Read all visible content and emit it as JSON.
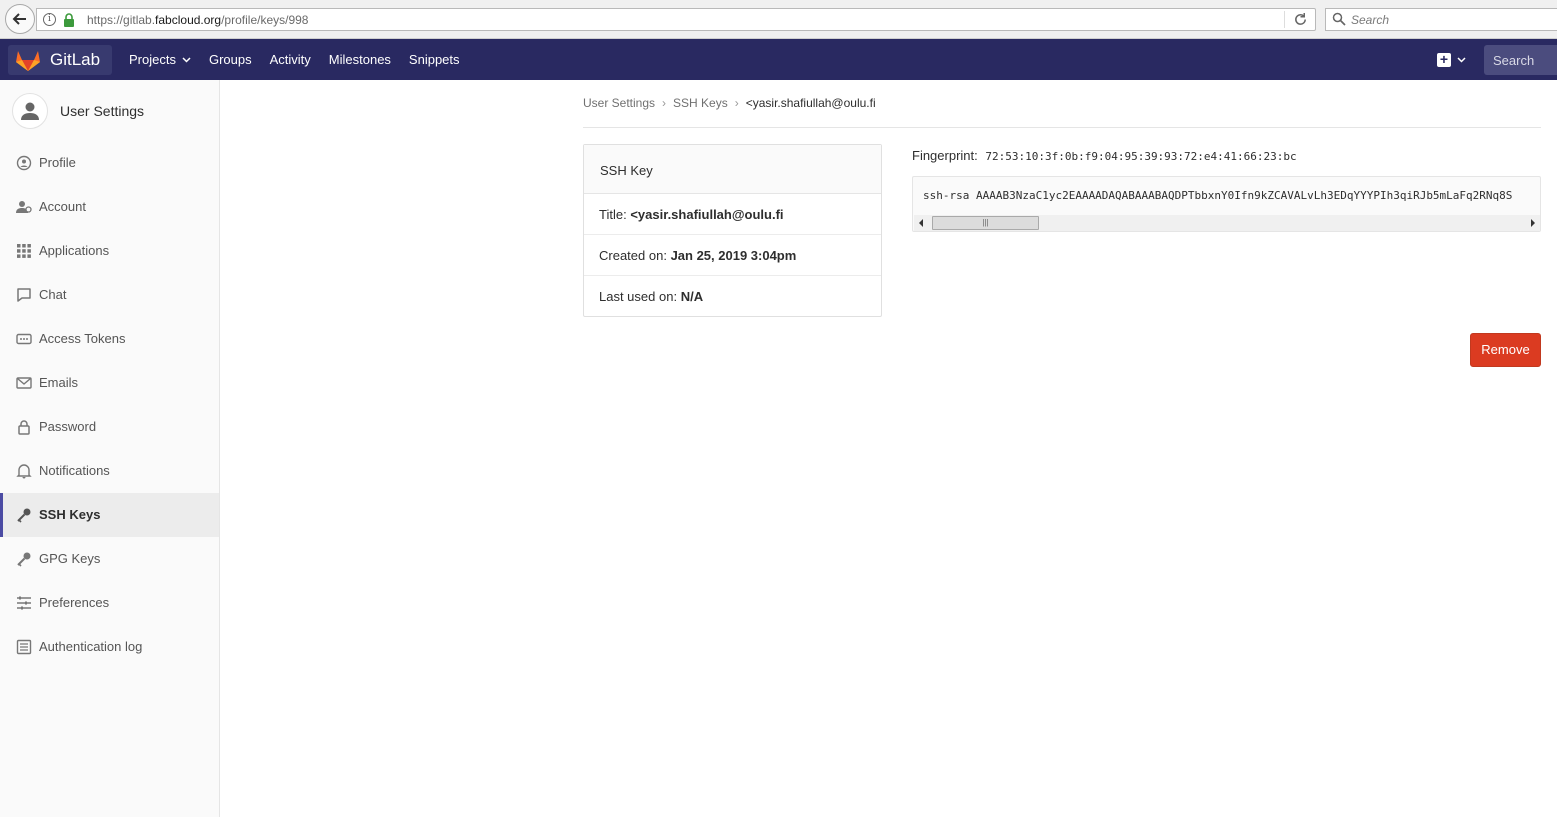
{
  "browser": {
    "url_prefix": "https://gitlab.",
    "url_domain": "fabcloud.org",
    "url_path": "/profile/keys/998",
    "search_placeholder": "Search"
  },
  "header": {
    "brand": "GitLab",
    "nav": [
      "Projects",
      "Groups",
      "Activity",
      "Milestones",
      "Snippets"
    ],
    "search_placeholder": "Search"
  },
  "sidebar": {
    "title": "User Settings",
    "items": [
      {
        "label": "Profile",
        "icon": "profile-icon"
      },
      {
        "label": "Account",
        "icon": "account-icon"
      },
      {
        "label": "Applications",
        "icon": "applications-icon"
      },
      {
        "label": "Chat",
        "icon": "chat-icon"
      },
      {
        "label": "Access Tokens",
        "icon": "token-icon"
      },
      {
        "label": "Emails",
        "icon": "mail-icon"
      },
      {
        "label": "Password",
        "icon": "lock-icon"
      },
      {
        "label": "Notifications",
        "icon": "bell-icon"
      },
      {
        "label": "SSH Keys",
        "icon": "key-icon",
        "active": true
      },
      {
        "label": "GPG Keys",
        "icon": "key-icon"
      },
      {
        "label": "Preferences",
        "icon": "preferences-icon"
      },
      {
        "label": "Authentication log",
        "icon": "log-icon"
      }
    ]
  },
  "breadcrumb": {
    "items": [
      "User Settings",
      "SSH Keys"
    ],
    "current": "<yasir.shafiullah@oulu.fi"
  },
  "key_card": {
    "heading": "SSH Key",
    "title_label": "Title:",
    "title_value": "<yasir.shafiullah@oulu.fi",
    "created_label": "Created on:",
    "created_value": "Jan 25, 2019 3:04pm",
    "last_used_label": "Last used on:",
    "last_used_value": "N/A"
  },
  "fingerprint": {
    "label": "Fingerprint:",
    "value": "72:53:10:3f:0b:f9:04:95:39:93:72:e4:41:66:23:bc"
  },
  "public_key": "ssh-rsa AAAAB3NzaC1yc2EAAAADAQABAAABAQDPTbbxnY0Ifn9kZCAVALvLh3EDqYYYPIh3qiRJb5mLaFq2RNq8S",
  "remove_label": "Remove",
  "colors": {
    "header_bg": "#292961",
    "active_indicator": "#4b4ba3",
    "remove_bg": "#db3b21"
  }
}
